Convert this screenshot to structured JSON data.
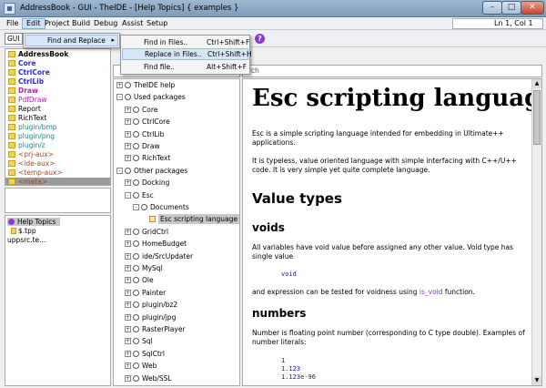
{
  "window": {
    "title": "AddressBook - GUI - TheIDE - [Help Topics] { examples }",
    "min_glyph": "–",
    "max_glyph": "□",
    "close_glyph": "✕"
  },
  "menubar": {
    "items": [
      "File",
      "Edit",
      "Project",
      "Build",
      "Debug",
      "Assist",
      "Setup"
    ],
    "status": "Ln 1, Col 1"
  },
  "toolbar": {
    "config": "GUI"
  },
  "edit_menu": {
    "find_replace": "Find and Replace",
    "arrow": "▸"
  },
  "submenu": {
    "items": [
      {
        "label": "Find in Files..",
        "shortcut": "Ctrl+Shift+F"
      },
      {
        "label": "Replace in Files..",
        "shortcut": "Ctrl+Shift+H"
      },
      {
        "label": "Find file..",
        "shortcut": "Alt+Shift+F"
      }
    ]
  },
  "packages": [
    {
      "name": "AddressBook",
      "color": "#000000",
      "bold": true
    },
    {
      "name": "Core",
      "color": "#2a2ad8",
      "bold": true
    },
    {
      "name": "CtrlCore",
      "color": "#2a2ad8",
      "bold": true
    },
    {
      "name": "CtrlLib",
      "color": "#2a2ad8",
      "bold": true
    },
    {
      "name": "Draw",
      "color": "#b020b0",
      "bold": true
    },
    {
      "name": "PdfDraw",
      "color": "#b020b0",
      "bold": false
    },
    {
      "name": "Report",
      "color": "#000000",
      "bold": false
    },
    {
      "name": "RichText",
      "color": "#000000",
      "bold": false
    },
    {
      "name": "plugin/bmp",
      "color": "#1a8a8a",
      "bold": false
    },
    {
      "name": "plugin/png",
      "color": "#1a8a8a",
      "bold": false
    },
    {
      "name": "plugin/z",
      "color": "#1a8a8a",
      "bold": false
    },
    {
      "name": "<prj-aux>",
      "color": "#a04a20",
      "bold": false
    },
    {
      "name": "<ide-aux>",
      "color": "#a04a20",
      "bold": false
    },
    {
      "name": "<temp-aux>",
      "color": "#a04a20",
      "bold": false
    },
    {
      "name": "<meta>",
      "color": "#a04a20",
      "bold": false
    }
  ],
  "help_topics": {
    "header": "Help Topics",
    "items": [
      "$.tpp",
      "uppsrc.te..."
    ]
  },
  "tree": [
    {
      "label": "TheIDE help",
      "level": 0,
      "exp": "+"
    },
    {
      "label": "Used packages",
      "level": 0,
      "exp": "-"
    },
    {
      "label": "Core",
      "level": 1,
      "exp": "+"
    },
    {
      "label": "CtrlCore",
      "level": 1,
      "exp": "+"
    },
    {
      "label": "CtrlLib",
      "level": 1,
      "exp": "+"
    },
    {
      "label": "Draw",
      "level": 1,
      "exp": "+"
    },
    {
      "label": "RichText",
      "level": 1,
      "exp": "+"
    },
    {
      "label": "Other packages",
      "level": 0,
      "exp": "-"
    },
    {
      "label": "Docking",
      "level": 1,
      "exp": "+"
    },
    {
      "label": "Esc",
      "level": 1,
      "exp": "-"
    },
    {
      "label": "Documents",
      "level": 2,
      "exp": "-"
    },
    {
      "label": "Esc scripting language",
      "level": 3,
      "exp": "",
      "doc": true,
      "selected": true
    },
    {
      "label": "GridCtrl",
      "level": 1,
      "exp": "+"
    },
    {
      "label": "HomeBudget",
      "level": 1,
      "exp": "+"
    },
    {
      "label": "ide/SrcUpdater",
      "level": 1,
      "exp": "+"
    },
    {
      "label": "MySql",
      "level": 1,
      "exp": "+"
    },
    {
      "label": "Ole",
      "level": 1,
      "exp": "+"
    },
    {
      "label": "Painter",
      "level": 1,
      "exp": "+"
    },
    {
      "label": "plugin/bz2",
      "level": 1,
      "exp": "+"
    },
    {
      "label": "plugin/jpg",
      "level": 1,
      "exp": "+"
    },
    {
      "label": "RasterPlayer",
      "level": 1,
      "exp": "+"
    },
    {
      "label": "Sql",
      "level": 1,
      "exp": "+"
    },
    {
      "label": "SqlCtrl",
      "level": 1,
      "exp": "+"
    },
    {
      "label": "Web",
      "level": 1,
      "exp": "+"
    },
    {
      "label": "Web/SSL",
      "level": 1,
      "exp": "+"
    }
  ],
  "doc": {
    "search_placeholder": "rch",
    "h1": "Esc scripting language",
    "intro1": "Esc is a simple scripting language intended for embedding in Ultimate++ applications.",
    "intro2": "It is typeless, value oriented language with simple interfacing with C++/U++ code. It is very simple yet quite complete language.",
    "h2_value_types": "Value types",
    "h3_voids": "voids",
    "voids_p1": "All variables have void value before assigned any other value. Void type has single value",
    "code_void": "void",
    "voids_p2_pre": "and expression can be tested for voidness using ",
    "voids_link": "is_void",
    "voids_p2_post": " function.",
    "h3_numbers": "numbers",
    "numbers_p": "Number is floating point number (corresponding to C type double). Examples of number literals:",
    "code_numbers": [
      "1",
      "1.123",
      "1.123e-96"
    ]
  }
}
